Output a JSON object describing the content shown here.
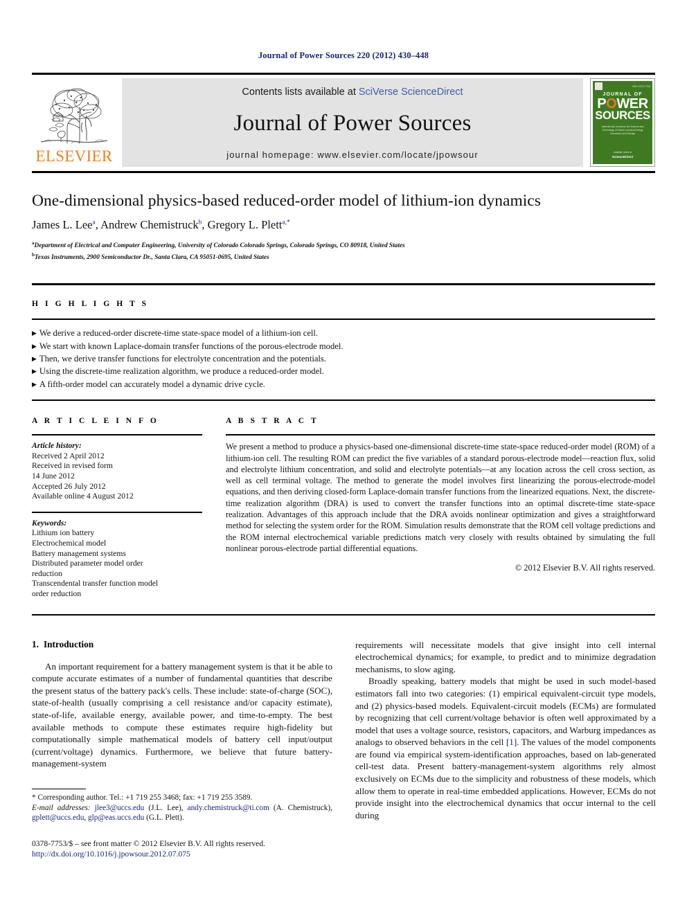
{
  "running_head": "Journal of Power Sources 220 (2012) 430–448",
  "masthead": {
    "publisher_logo_text": "ELSEVIER",
    "contents_prefix": "Contents lists available at ",
    "contents_link": "SciVerse ScienceDirect",
    "journal_name": "Journal of Power Sources",
    "homepage_line": "journal homepage: www.elsevier.com/locate/jpowsour",
    "cover": {
      "issn_line": "ISSN 0378-7753",
      "journal_of": "JOURNAL OF",
      "power": "POWER",
      "sources": "SOURCES",
      "subtitle": "International Journal on the Science and Technology of Electro‐chemical Energy Conversion and Storage",
      "foot_line1": "Available online at",
      "foot_line2": "ScienceDirect"
    }
  },
  "article": {
    "title": "One-dimensional physics-based reduced-order model of lithium-ion dynamics",
    "authors_html": "James L. Lee<sup>a</sup>, Andrew Chemistruck<sup>b</sup>, Gregory L. Plett<sup>a,*</sup>",
    "affiliations": [
      {
        "marker": "a",
        "text": "Department of Electrical and Computer Engineering, University of Colorado Colorado Springs, Colorado Springs, CO 80918, United States"
      },
      {
        "marker": "b",
        "text": "Texas Instruments, 2900 Semiconductor Dr., Santa Clara, CA 95051-0695, United States"
      }
    ]
  },
  "highlights": {
    "heading": "H I G H L I G H T S",
    "bullet_glyph": "▶",
    "items": [
      "We derive a reduced-order discrete-time state-space model of a lithium-ion cell.",
      "We start with known Laplace-domain transfer functions of the porous-electrode model.",
      "Then, we derive transfer functions for electrolyte concentration and the potentials.",
      "Using the discrete-time realization algorithm, we produce a reduced-order model.",
      "A fifth-order model can accurately model a dynamic drive cycle."
    ]
  },
  "article_info": {
    "heading": "A R T I C L E   I N F O",
    "history_label": "Article history:",
    "history": [
      "Received 2 April 2012",
      "Received in revised form",
      "14 June 2012",
      "Accepted 26 July 2012",
      "Available online 4 August 2012"
    ],
    "keywords_label": "Keywords:",
    "keywords": [
      "Lithium ion battery",
      "Electrochemical model",
      "Battery management systems",
      "Distributed parameter model order",
      "reduction",
      "Transcendental transfer function model",
      "order reduction"
    ]
  },
  "abstract": {
    "heading": "A B S T R A C T",
    "body": "We present a method to produce a physics-based one-dimensional discrete-time state-space reduced-order model (ROM) of a lithium-ion cell. The resulting ROM can predict the five variables of a standard porous-electrode model—reaction flux, solid and electrolyte lithium concentration, and solid and electrolyte potentials—at any location across the cell cross section, as well as cell terminal voltage. The method to generate the model involves first linearizing the porous-electrode-model equations, and then deriving closed-form Laplace-domain transfer functions from the linearized equations. Next, the discrete-time realization algorithm (DRA) is used to convert the transfer functions into an optimal discrete-time state-space realization. Advantages of this approach include that the DRA avoids nonlinear optimization and gives a straightforward method for selecting the system order for the ROM. Simulation results demonstrate that the ROM cell voltage predictions and the ROM internal electrochemical variable predictions match very closely with results obtained by simulating the full nonlinear porous-electrode partial differential equations.",
    "copyright": "© 2012 Elsevier B.V. All rights reserved."
  },
  "body": {
    "section_number": "1.",
    "section_title": "Introduction",
    "left_paragraph": "An important requirement for a battery management system is that it be able to compute accurate estimates of a number of fundamental quantities that describe the present status of the battery pack's cells. These include: state-of-charge (SOC), state-of-health (usually comprising a cell resistance and/or capacity estimate), state-of-life, available energy, available power, and time-to-empty. The best available methods to compute these estimates require high-fidelity but computationally simple mathematical models of battery cell input/output (current/voltage) dynamics. Furthermore, we believe that future battery-management-system",
    "right_paragraph_1": "requirements will necessitate models that give insight into cell internal electrochemical dynamics; for example, to predict and to minimize degradation mechanisms, to slow aging.",
    "right_paragraph_2_a": "Broadly speaking, battery models that might be used in such model-based estimators fall into two categories: (1) empirical equivalent-circuit type models, and (2) physics-based models. Equivalent-circuit models (ECMs) are formulated by recognizing that cell current/voltage behavior is often well approximated by a model that uses a voltage source, resistors, capacitors, and Warburg impedances as analogs to observed behaviors in the cell ",
    "right_paragraph_2_ref": "[1]",
    "right_paragraph_2_b": ". The values of the model components are found via empirical system-identification approaches, based on lab-generated cell-test data. Present battery-management-system algorithms rely almost exclusively on ECMs due to the simplicity and robustness of these models, which allow them to operate in real-time embedded applications. However, ECMs do not provide insight into the electrochemical dynamics that occur internal to the cell during"
  },
  "footnotes": {
    "corresponding": "* Corresponding author. Tel.: +1 719 255 3468; fax: +1 719 255 3589.",
    "email_label": "E-mail addresses:",
    "email_1": "jlee3@uccs.edu",
    "email_1_who": " (J.L. Lee), ",
    "email_2": "andy.chemistruck@ti.com",
    "email_2_who": " (A. Chemistruck), ",
    "email_3": "gplett@uccs.edu",
    "email_sep": ", ",
    "email_4": "glp@eas.uccs.edu",
    "email_4_who": " (G.L. Plett).",
    "issn_line": "0378-7753/$ – see front matter © 2012 Elsevier B.V. All rights reserved.",
    "doi": "http://dx.doi.org/10.1016/j.jpowsour.2012.07.075"
  },
  "colors": {
    "link_blue": "#16257b",
    "sciencedirect_blue": "#3d5ca8",
    "elsevier_orange": "#f07f1a",
    "cover_green": "#3f7a23",
    "banner_gray": "#e3e3e3"
  }
}
